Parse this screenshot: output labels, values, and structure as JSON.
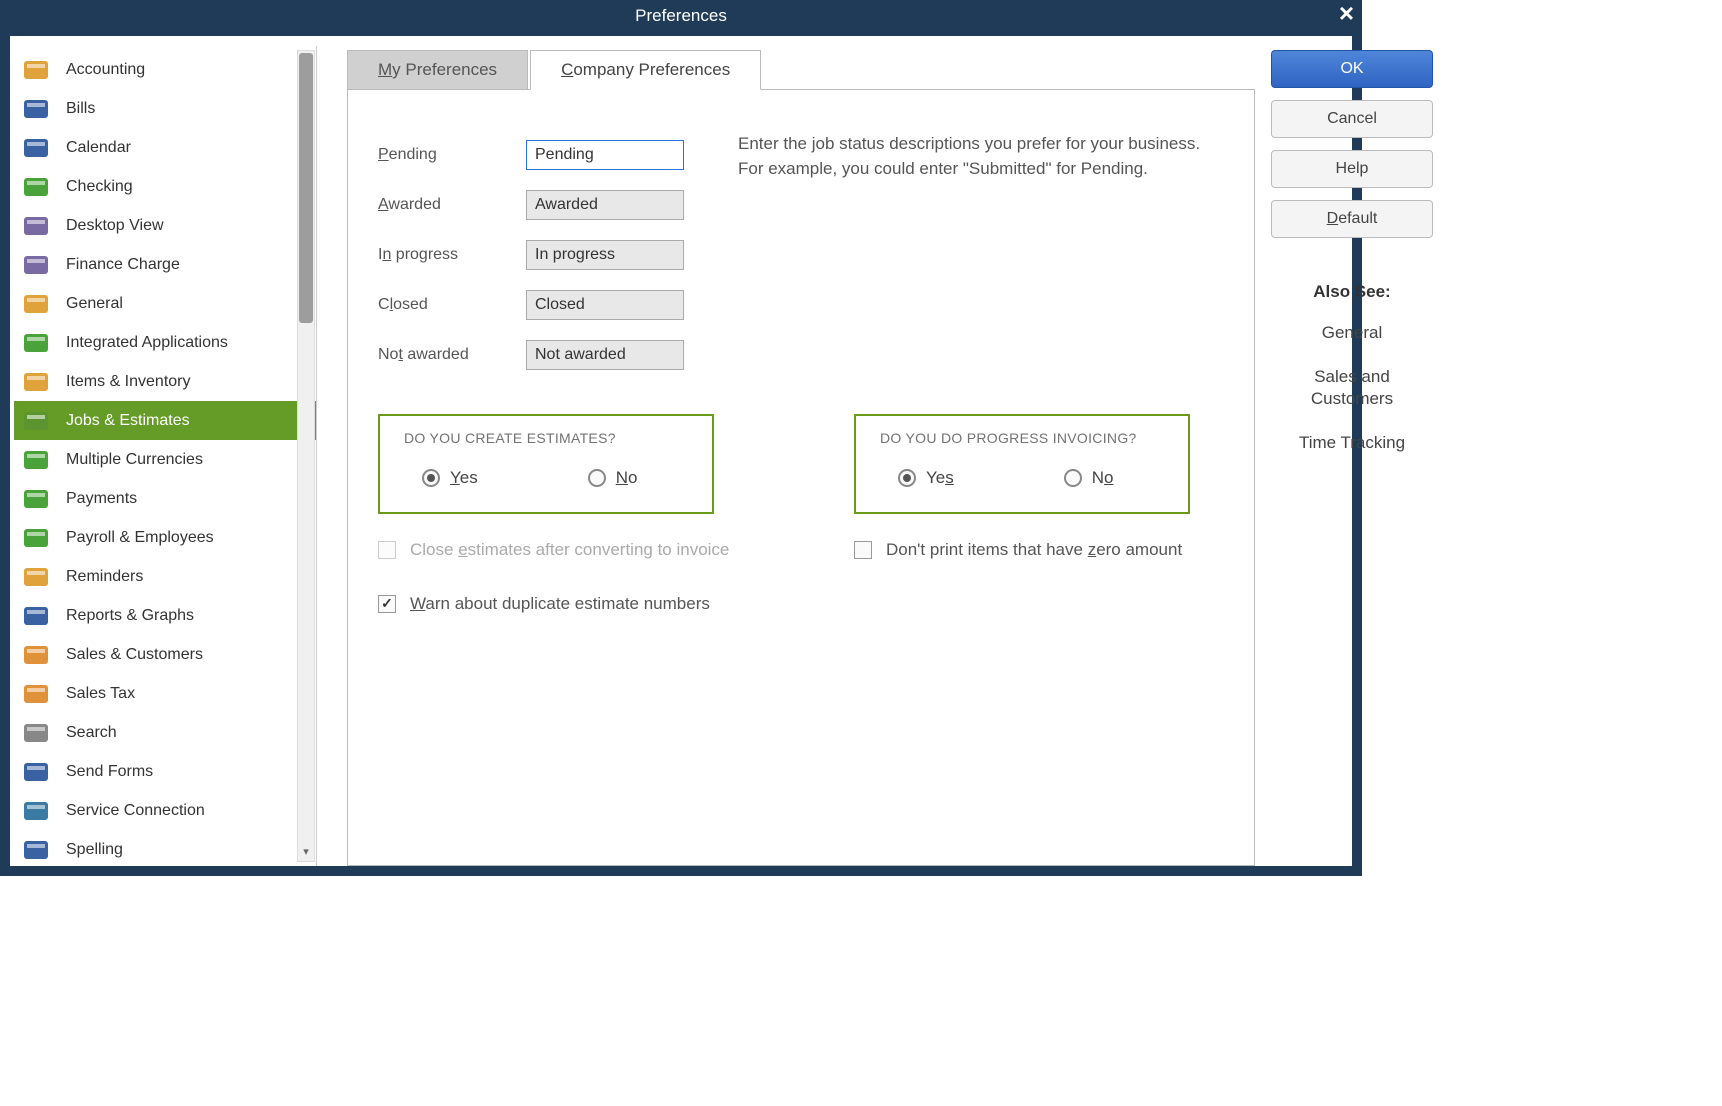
{
  "window": {
    "title": "Preferences"
  },
  "sidebar": {
    "items": [
      {
        "label": "Accounting",
        "id": "accounting",
        "icon_bg": "#e0a23a"
      },
      {
        "label": "Bills",
        "id": "bills",
        "icon_bg": "#3a62a3"
      },
      {
        "label": "Calendar",
        "id": "calendar",
        "icon_bg": "#3a62a3"
      },
      {
        "label": "Checking",
        "id": "checking",
        "icon_bg": "#4aa33a"
      },
      {
        "label": "Desktop View",
        "id": "desktop-view",
        "icon_bg": "#7a6aa3"
      },
      {
        "label": "Finance Charge",
        "id": "finance-charge",
        "icon_bg": "#7a6aa3"
      },
      {
        "label": "General",
        "id": "general",
        "icon_bg": "#e0a23a"
      },
      {
        "label": "Integrated Applications",
        "id": "integrated-apps",
        "icon_bg": "#4aa33a"
      },
      {
        "label": "Items & Inventory",
        "id": "items-inventory",
        "icon_bg": "#e0a23a"
      },
      {
        "label": "Jobs & Estimates",
        "id": "jobs-estimates",
        "icon_bg": "#5c9430",
        "selected": true
      },
      {
        "label": "Multiple Currencies",
        "id": "multiple-currencies",
        "icon_bg": "#4aa33a"
      },
      {
        "label": "Payments",
        "id": "payments",
        "icon_bg": "#4aa33a"
      },
      {
        "label": "Payroll & Employees",
        "id": "payroll",
        "icon_bg": "#4aa33a"
      },
      {
        "label": "Reminders",
        "id": "reminders",
        "icon_bg": "#e0a23a"
      },
      {
        "label": "Reports & Graphs",
        "id": "reports-graphs",
        "icon_bg": "#3a62a3"
      },
      {
        "label": "Sales & Customers",
        "id": "sales-customers",
        "icon_bg": "#e0923a"
      },
      {
        "label": "Sales Tax",
        "id": "sales-tax",
        "icon_bg": "#e0923a"
      },
      {
        "label": "Search",
        "id": "search",
        "icon_bg": "#888888"
      },
      {
        "label": "Send Forms",
        "id": "send-forms",
        "icon_bg": "#3a62a3"
      },
      {
        "label": "Service Connection",
        "id": "service-connection",
        "icon_bg": "#3a7aa3"
      },
      {
        "label": "Spelling",
        "id": "spelling",
        "icon_bg": "#3a62a3"
      }
    ]
  },
  "tabs": {
    "my": "My Preferences",
    "company": "Company Preferences",
    "active": "company"
  },
  "status": {
    "instruction": "Enter the job status descriptions you prefer for your business.  For example, you could enter \"Submitted\" for Pending.",
    "rows": [
      {
        "label": "Pending",
        "value": "Pending",
        "focused": true
      },
      {
        "label": "Awarded",
        "value": "Awarded"
      },
      {
        "label": "In progress",
        "value": "In progress"
      },
      {
        "label": "Closed",
        "value": "Closed"
      },
      {
        "label": "Not awarded",
        "value": "Not awarded"
      }
    ]
  },
  "questions": {
    "estimates": {
      "title": "DO YOU CREATE ESTIMATES?",
      "yes": "Yes",
      "no": "No",
      "value": "yes"
    },
    "progress": {
      "title": "DO YOU DO PROGRESS INVOICING?",
      "yes": "Yes",
      "no": "No",
      "value": "yes"
    }
  },
  "checks": {
    "close_after": {
      "label": "Close estimates after converting to invoice",
      "checked": false,
      "disabled": true
    },
    "dont_print_zero": {
      "label": "Don't print items that have zero amount",
      "checked": false
    },
    "warn_dup": {
      "label": "Warn about duplicate estimate numbers",
      "checked": true
    }
  },
  "buttons": {
    "ok": "OK",
    "cancel": "Cancel",
    "help": "Help",
    "default": "Default"
  },
  "also_see": {
    "title": "Also See:",
    "links": [
      "General",
      "Sales and Customers",
      "Time Tracking"
    ]
  }
}
